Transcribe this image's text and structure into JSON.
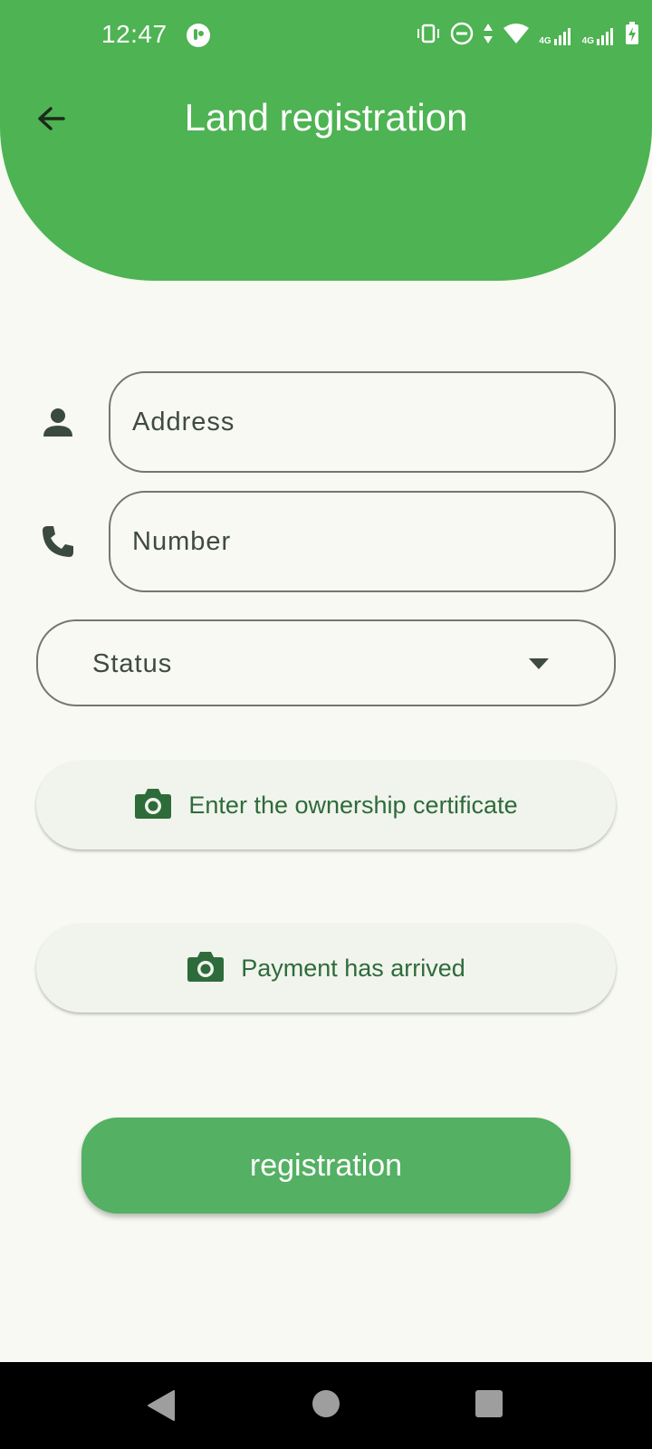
{
  "status_bar": {
    "time": "12:47",
    "app_icon": "app-notification-icon",
    "icons": [
      "vibrate-icon",
      "dnd-icon",
      "data-arrows-icon",
      "wifi-icon",
      "signal-4g-1-icon",
      "signal-4g-2-icon",
      "battery-charging-icon"
    ],
    "net_label_1": "4G",
    "net_label_2": "4G"
  },
  "header": {
    "title": "Land registration",
    "back_icon": "arrow-back-icon",
    "color": "#4eb352"
  },
  "form": {
    "address": {
      "placeholder": "Address",
      "value": "",
      "icon": "person-icon"
    },
    "number": {
      "placeholder": "Number",
      "value": "",
      "icon": "phone-icon"
    },
    "status": {
      "selected": "Status",
      "icon": "caret-down-icon"
    },
    "ownership_button": {
      "label": "Enter the ownership certificate",
      "icon": "camera-icon"
    },
    "payment_button": {
      "label": "Payment has arrived",
      "icon": "camera-icon"
    },
    "submit_button": {
      "label": "registration",
      "color": "#54b063"
    }
  },
  "nav": {
    "back": "nav-back-icon",
    "home": "nav-home-icon",
    "recents": "nav-recents-icon"
  }
}
